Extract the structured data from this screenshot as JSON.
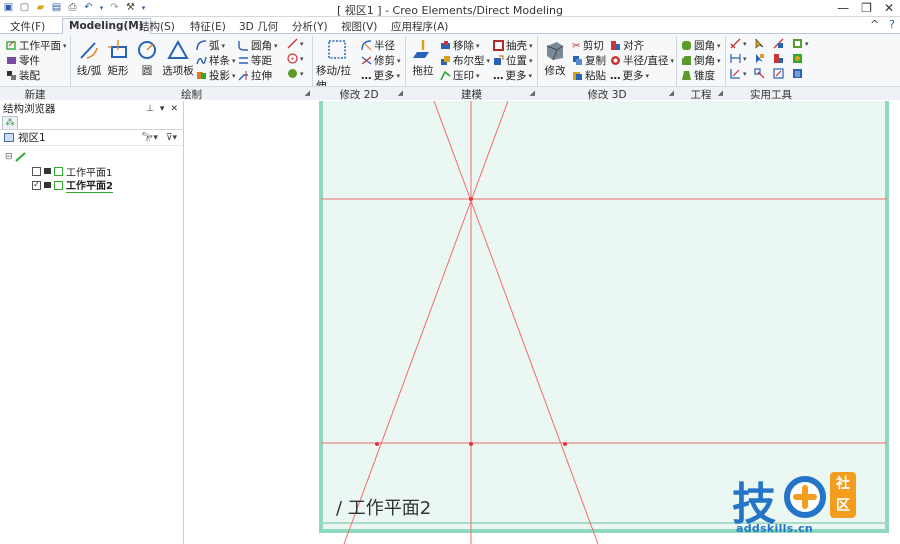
{
  "titlebar": {
    "title": "[ 视区1 ] - Creo Elements/Direct Modeling",
    "controls": [
      "—",
      "❐",
      "✕"
    ]
  },
  "tabs": [
    {
      "label": "文件(F)",
      "active": false
    },
    {
      "label": "Modeling(M)",
      "active": true
    },
    {
      "label": "结构(S)",
      "active": false
    },
    {
      "label": "特征(E)",
      "active": false
    },
    {
      "label": "3D 几何",
      "active": false
    },
    {
      "label": "分析(Y)",
      "active": false
    },
    {
      "label": "视图(V)",
      "active": false
    },
    {
      "label": "应用程序(A)",
      "active": false
    }
  ],
  "ribbon": {
    "new_group": {
      "label": "新建",
      "items": [
        "工作平面",
        "零件",
        "装配"
      ]
    },
    "draw_group": {
      "label": "绘制",
      "big": [
        "线/弧",
        "矩形",
        "圆",
        "选项板"
      ],
      "small_a": [
        "弧",
        "样条",
        "投影"
      ],
      "small_b": [
        "圆角",
        "等距",
        "拉伸"
      ]
    },
    "modify2d_group": {
      "label": "修改 2D",
      "big": "移动/拉伸",
      "small": [
        "半径",
        "修剪",
        "更多"
      ]
    },
    "model_group": {
      "label": "建模",
      "big": "拖拉",
      "small_a": [
        "移除",
        "布尔型",
        "压印"
      ],
      "small_b": [
        "抽壳",
        "位置",
        "更多"
      ]
    },
    "modify3d_group": {
      "label": "修改 3D",
      "big": "修改",
      "small_a": [
        "剪切",
        "复制",
        "粘贴"
      ],
      "small_b": [
        "对齐",
        "半径/直径",
        "更多"
      ]
    },
    "eng_group": {
      "label": "工程",
      "items": [
        "圆角",
        "倒角",
        "锥度"
      ]
    },
    "util_group": {
      "label": "实用工具"
    }
  },
  "panel": {
    "title": "结构浏览器",
    "view": "视区1",
    "items": [
      {
        "label": "工作平面1",
        "checked": false,
        "bold": false
      },
      {
        "label": "工作平面2",
        "checked": true,
        "bold": true
      }
    ]
  },
  "viewport": {
    "workplane_label": "/ 工作平面2",
    "plane_fill": "#eaf7f3",
    "border_color": "#8fd9c1",
    "line_color": "#ef6e6e"
  },
  "watermark": {
    "text": "技",
    "badge": "社区",
    "url": "addskills.cn"
  }
}
